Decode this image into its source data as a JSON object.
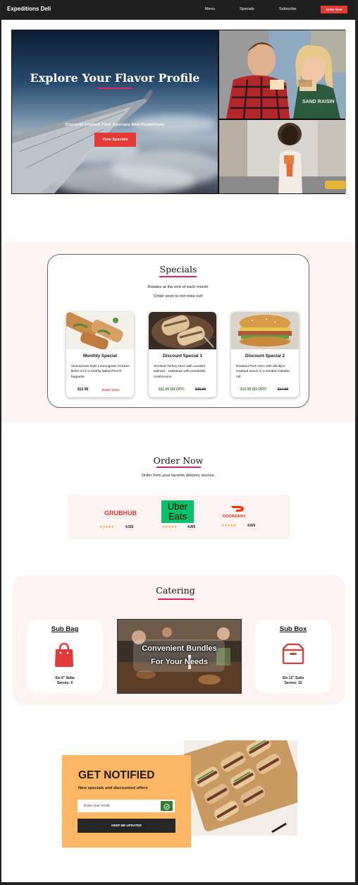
{
  "nav": {
    "brand": "Expeditions Deli",
    "links": [
      "Menu",
      "Specials",
      "Subscribe"
    ],
    "order_button": "Order Now"
  },
  "hero": {
    "title": "Explore Your Flavor Profile",
    "subtitle": "Discover Limited-Time Specials And Promotions",
    "button": "View Specials",
    "photo1_sign": "SAND RAISIN"
  },
  "specials": {
    "title": "Specials",
    "line1": "Rotates at the end of each month.",
    "line2": "Order soon to not miss out!",
    "items": [
      {
        "name": "Monthly Special",
        "description": "Vietnamese-style Lemongrass Chicken Bahn-mi in a freshly baked french baguette.",
        "price": "$12.99",
        "tag": "Ends 12/31"
      },
      {
        "name": "Discount Special 1",
        "description": "Smoked Turkey Hero with candied walnuts - substitute with portobello mushrooms.",
        "price": "$11.99 ($4 OFF)",
        "old_price": "$15.99"
      },
      {
        "name": "Discount Special 2",
        "description": "Roasted Pork Hero with dill-dijon mustard sauce in a seeded ciabatta roll.",
        "price": "$10.99 ($3 OFF)",
        "old_price": "$14.99"
      }
    ]
  },
  "order": {
    "title": "Order Now",
    "subtitle": "Order from your favorite delivery service.",
    "services": [
      {
        "name": "GRUBHUB",
        "stars": "★★★★★",
        "rating": "4.5/5",
        "color": "#e53935"
      },
      {
        "name_line1": "Uber",
        "name_line2": "Eats",
        "stars": "★★★★★",
        "rating": "4.8/5",
        "color": "#06c167"
      },
      {
        "name": "DOORDASH",
        "stars": "★★★★★",
        "rating": "4.6/5",
        "color": "#ff3008"
      }
    ]
  },
  "catering": {
    "title": "Catering",
    "photo_text_line1": "Convenient Bundles",
    "photo_text_line2": "For Your Needs",
    "bag": {
      "title": "Sub Bag",
      "line1": "Six 6\" Subs",
      "line2": "Serves: 6"
    },
    "box": {
      "title": "Sub Box",
      "line1": "Six 12\" Subs",
      "line2": "Serves: 12"
    }
  },
  "notify": {
    "title": "GET NOTIFIED",
    "subtitle": "New specials and discounted offers",
    "placeholder": "Enter your email",
    "button": "KEEP ME UPDATED"
  },
  "colors": {
    "accent_red": "#e53935",
    "underline_pink": "#e0245e",
    "band_pink": "#fdf3f3",
    "notify_orange": "#fdb663",
    "green": "#4a7c3a"
  }
}
